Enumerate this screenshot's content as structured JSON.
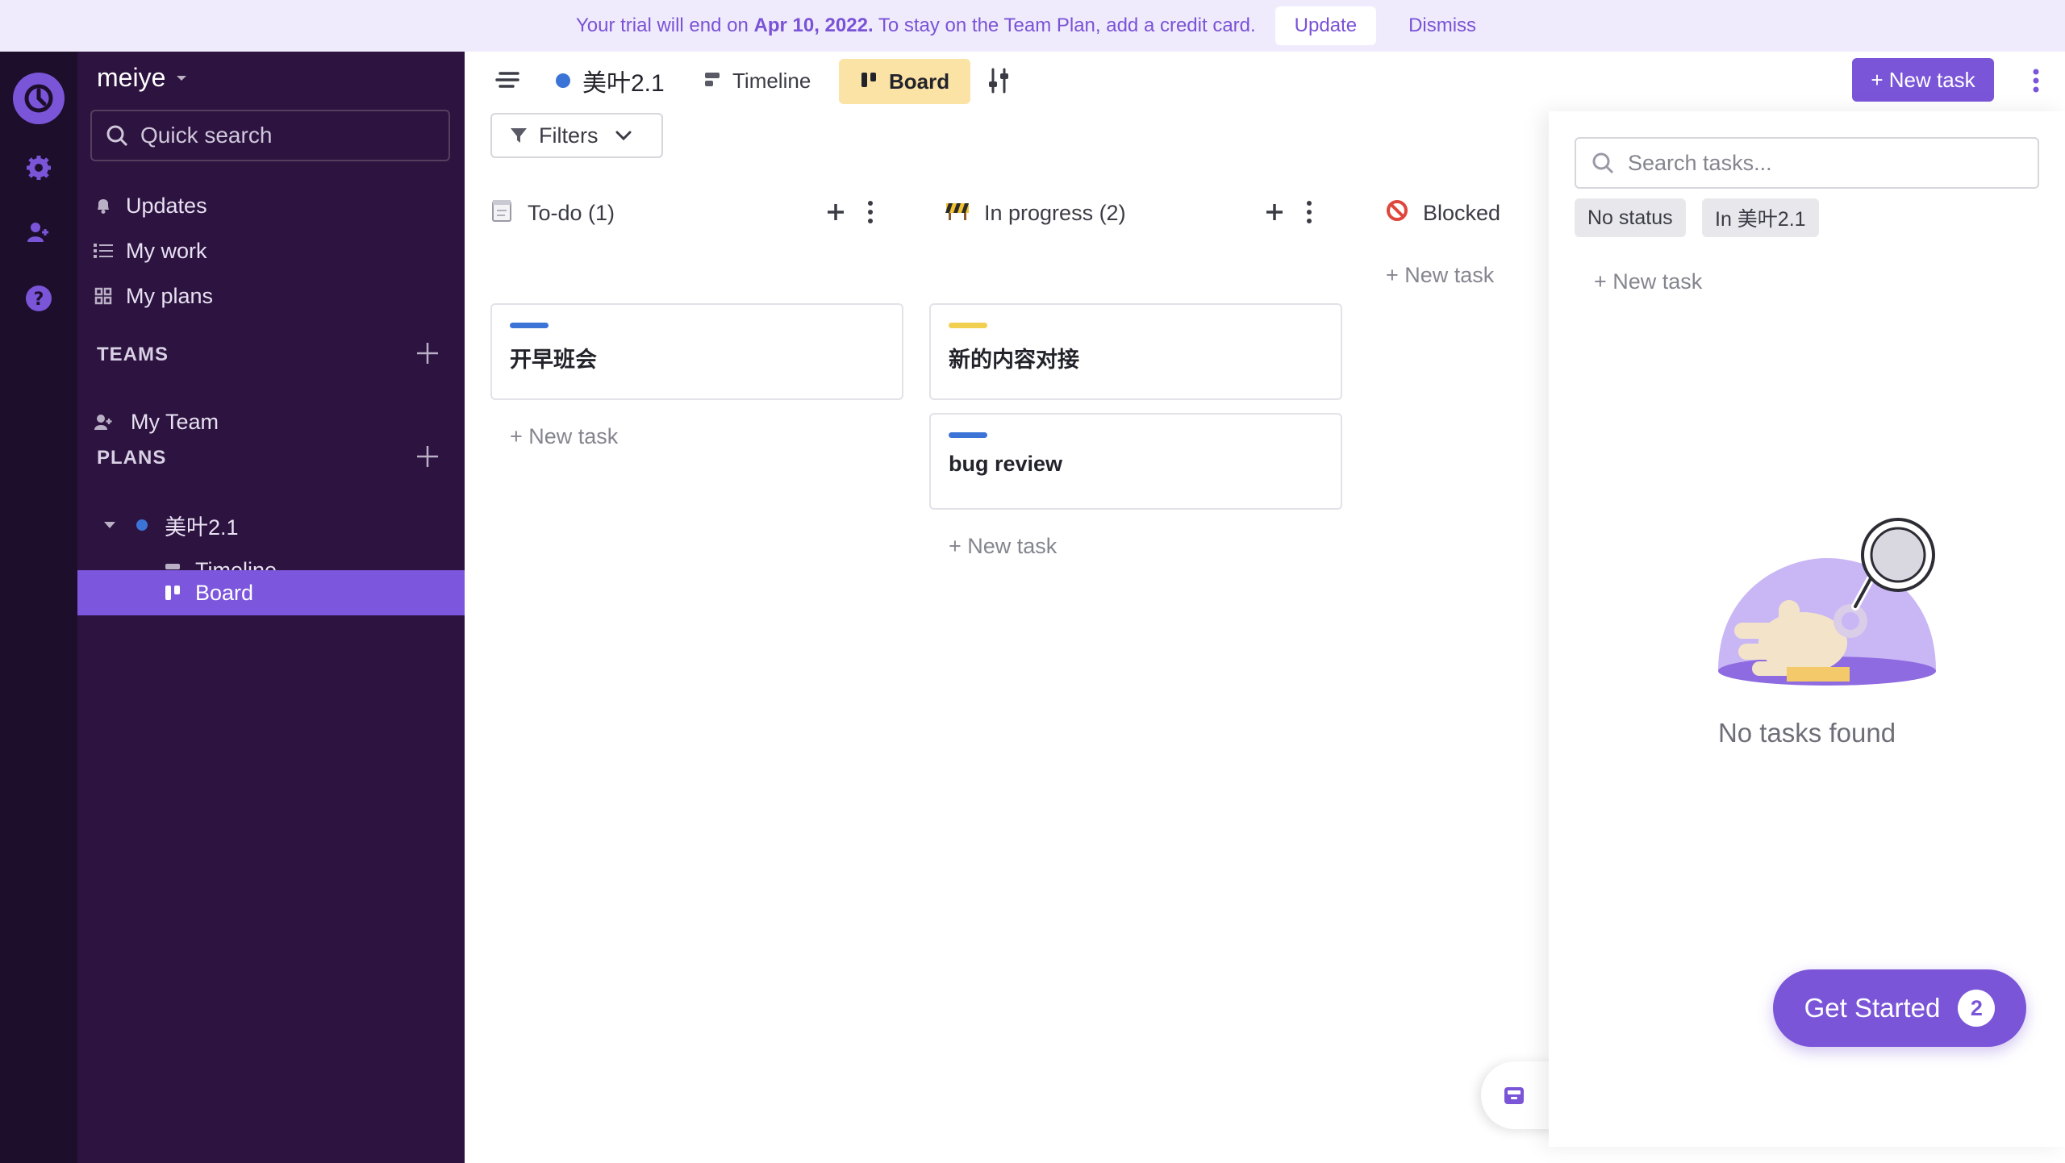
{
  "banner": {
    "text_pre": "Your trial will end on",
    "date": "Apr 10, 2022.",
    "text_post": "To stay on the Team Plan, add a credit card.",
    "update_label": "Update",
    "dismiss_label": "Dismiss"
  },
  "sidebar": {
    "workspace": "meiye",
    "search_placeholder": "Quick search",
    "nav": [
      {
        "label": "Updates",
        "icon": "bell-icon"
      },
      {
        "label": "My work",
        "icon": "list-icon"
      },
      {
        "label": "My plans",
        "icon": "grid-icon"
      }
    ],
    "teams_heading": "TEAMS",
    "teams": [
      {
        "label": "My Team",
        "icon": "team-icon"
      }
    ],
    "plans_heading": "PLANS",
    "plan": {
      "label": "美叶2.1",
      "color": "#3b74d6"
    },
    "plan_views": [
      {
        "label": "Timeline",
        "icon": "timeline-icon"
      },
      {
        "label": "Board",
        "icon": "board-icon",
        "active": true
      }
    ]
  },
  "topbar": {
    "plan_name": "美叶2.1",
    "tab_timeline": "Timeline",
    "tab_board": "Board",
    "new_task_label": "+ New task",
    "filters_label": "Filters"
  },
  "columns": [
    {
      "title": "To-do (1)",
      "icon": "notepad-icon",
      "cards": [
        {
          "title": "开早班会",
          "color": "#3b74d6"
        }
      ],
      "add_label": "+ New task"
    },
    {
      "title": "In progress (2)",
      "icon": "construction-icon",
      "cards": [
        {
          "title": "新的内容对接",
          "color": "#f2d04f"
        },
        {
          "title": "bug review",
          "color": "#3b74d6"
        }
      ],
      "add_label": "+ New task"
    },
    {
      "title": "Blocked",
      "icon": "no-entry-icon",
      "cards": [],
      "add_label": "+ New task"
    }
  ],
  "panel": {
    "search_placeholder": "Search tasks...",
    "chips": [
      "No status",
      "In 美叶2.1"
    ],
    "add_label": "+ New task",
    "empty_text": "No tasks found"
  },
  "get_started": {
    "label": "Get Started",
    "count": "2"
  },
  "colors": {
    "accent": "#7b55d8",
    "rail": "#1d0e2c",
    "sidebar": "#2d1340",
    "board_tab": "#fbe3a5"
  }
}
